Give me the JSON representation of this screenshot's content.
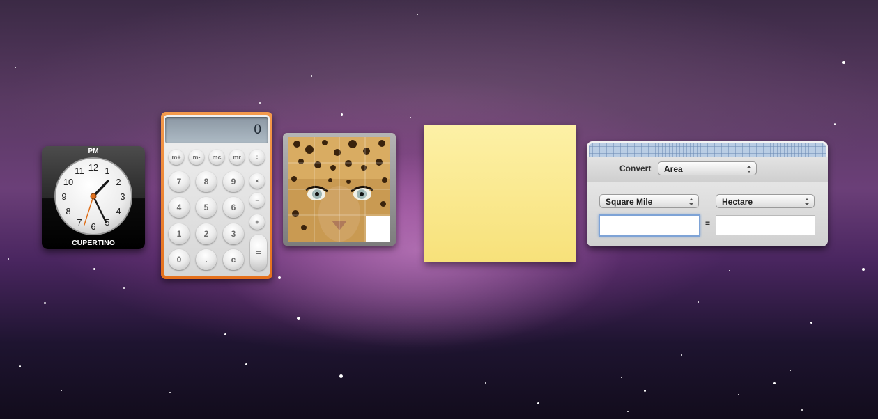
{
  "clock": {
    "ampm": "PM",
    "city": "CUPERTINO",
    "numerals": [
      "12",
      "1",
      "2",
      "3",
      "4",
      "5",
      "6",
      "7",
      "8",
      "9",
      "10",
      "11"
    ]
  },
  "calculator": {
    "display": "0",
    "memory_keys": [
      "m+",
      "m-",
      "mc",
      "mr"
    ],
    "divide": "÷",
    "multiply": "×",
    "minus": "−",
    "plus": "+",
    "equals": "=",
    "rows": [
      [
        "7",
        "8",
        "9"
      ],
      [
        "4",
        "5",
        "6"
      ],
      [
        "1",
        "2",
        "3"
      ]
    ],
    "zero": "0",
    "decimal": ".",
    "clear": "c"
  },
  "converter": {
    "convert_label": "Convert",
    "category": "Area",
    "from_unit": "Square Mile",
    "to_unit": "Hectare",
    "from_value": "",
    "to_value": "",
    "equals": "="
  },
  "colors": {
    "calculator_frame": "#ee7b24",
    "sticky_note": "#fbe98f",
    "focus_ring": "#7ea3d6"
  }
}
